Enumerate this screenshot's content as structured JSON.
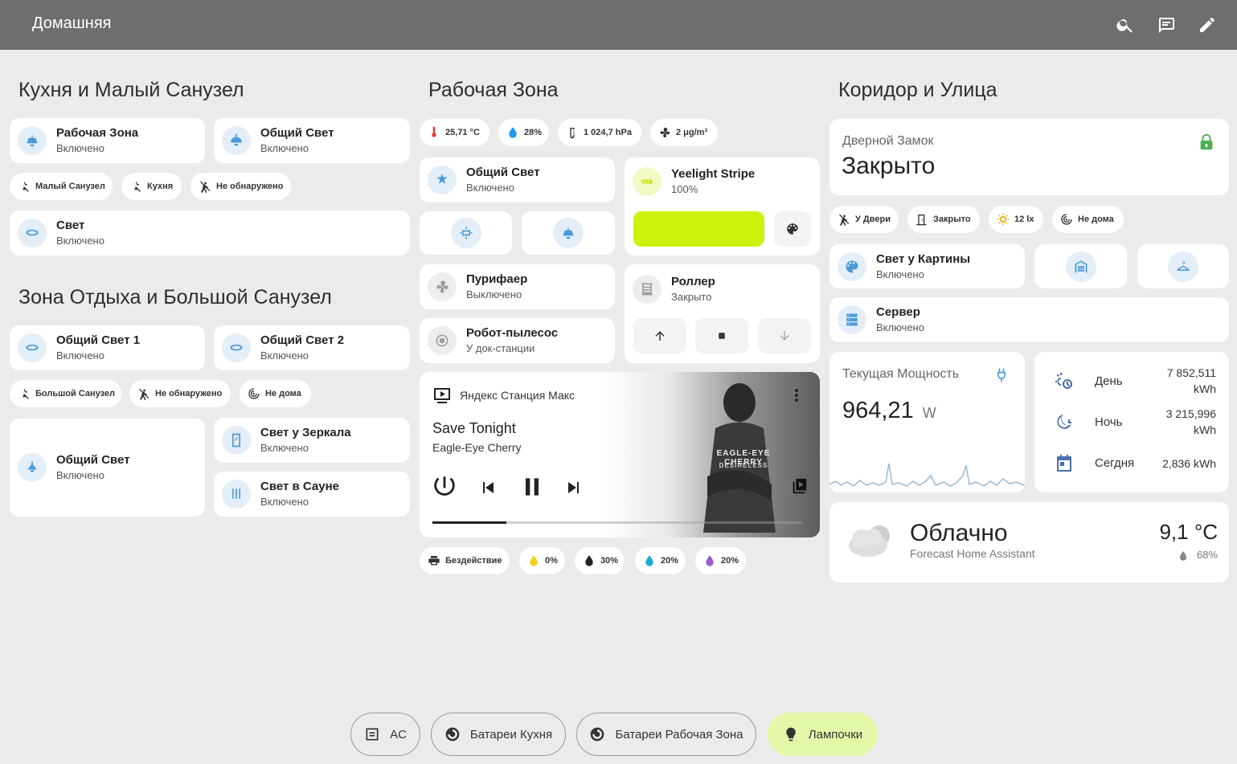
{
  "app": {
    "title": "Домашняя"
  },
  "sections": {
    "kitchen": "Кухня и Малый Санузел",
    "work": "Рабочая Зона",
    "corridor": "Коридор и Улица",
    "rest": "Зона Отдыха и Большой Санузел"
  },
  "kitchen": {
    "tiles": [
      {
        "name": "Рабочая Зона",
        "state": "Включено"
      },
      {
        "name": "Общий Свет",
        "state": "Включено"
      },
      {
        "name": "Свет",
        "state": "Включено"
      }
    ],
    "chips": [
      "Малый Санузел",
      "Кухня",
      "Не обнаружено"
    ]
  },
  "rest": {
    "tiles": [
      {
        "name": "Общий Свет 1",
        "state": "Включено"
      },
      {
        "name": "Общий Свет 2",
        "state": "Включено"
      },
      {
        "name": "Общий Свет",
        "state": "Включено"
      },
      {
        "name": "Свет у Зеркала",
        "state": "Включено"
      },
      {
        "name": "Свет в Сауне",
        "state": "Включено"
      }
    ],
    "chips": [
      "Большой Санузел",
      "Не обнаружено",
      "Не дома"
    ]
  },
  "work": {
    "sensors": [
      "25,71 °C",
      "28%",
      "1 024,7 hPa",
      "2 μg/m³"
    ],
    "tiles": [
      {
        "name": "Общий Свет",
        "state": "Включено"
      },
      {
        "name": "Yeelight Stripe",
        "state": "100%"
      },
      {
        "name": "Пурифаер",
        "state": "Выключено"
      },
      {
        "name": "Роллер",
        "state": "Закрыто"
      },
      {
        "name": "Робот-пылесос",
        "state": "У док-станции"
      }
    ],
    "light_color": "#cdf00d",
    "media": {
      "device": "Яндекс Станция Макс",
      "track": "Save Tonight",
      "artist": "Eagle-Eye Cherry",
      "cover_line1": "EAGLE-EYE CHERRY",
      "cover_line2": "DESIRELESS",
      "progress": 0.2
    },
    "printer_chips": [
      "Бездействие",
      "0%",
      "30%",
      "20%",
      "20%"
    ],
    "ink_colors": [
      "#f2d21b",
      "#222222",
      "#1ba8d8",
      "#9b59d0"
    ]
  },
  "corridor": {
    "lock": {
      "label": "Дверной Замок",
      "state": "Закрыто",
      "color": "#4caf50"
    },
    "chips": [
      "У Двери",
      "Закрыто",
      "12 lx",
      "Не дома"
    ],
    "tiles": [
      {
        "name": "Свет у Картины",
        "state": "Включено"
      },
      {
        "name": "Сервер",
        "state": "Включено"
      }
    ],
    "power": {
      "label": "Текущая Мощность",
      "value": "964,21",
      "unit": "W"
    },
    "energy": [
      {
        "label": "День",
        "value": "7 852,511",
        "unit": "kWh"
      },
      {
        "label": "Ночь",
        "value": "3 215,996",
        "unit": "kWh"
      },
      {
        "label": "Сегдня",
        "value": "2,836 kWh",
        "unit": ""
      }
    ],
    "weather": {
      "condition": "Облачно",
      "source": "Forecast Home Assistant",
      "temp": "9,1 °C",
      "humidity": "68%"
    }
  },
  "bottom": [
    "AC",
    "Батареи Кухня",
    "Батареи Рабочая Зона",
    "Лампочки"
  ]
}
